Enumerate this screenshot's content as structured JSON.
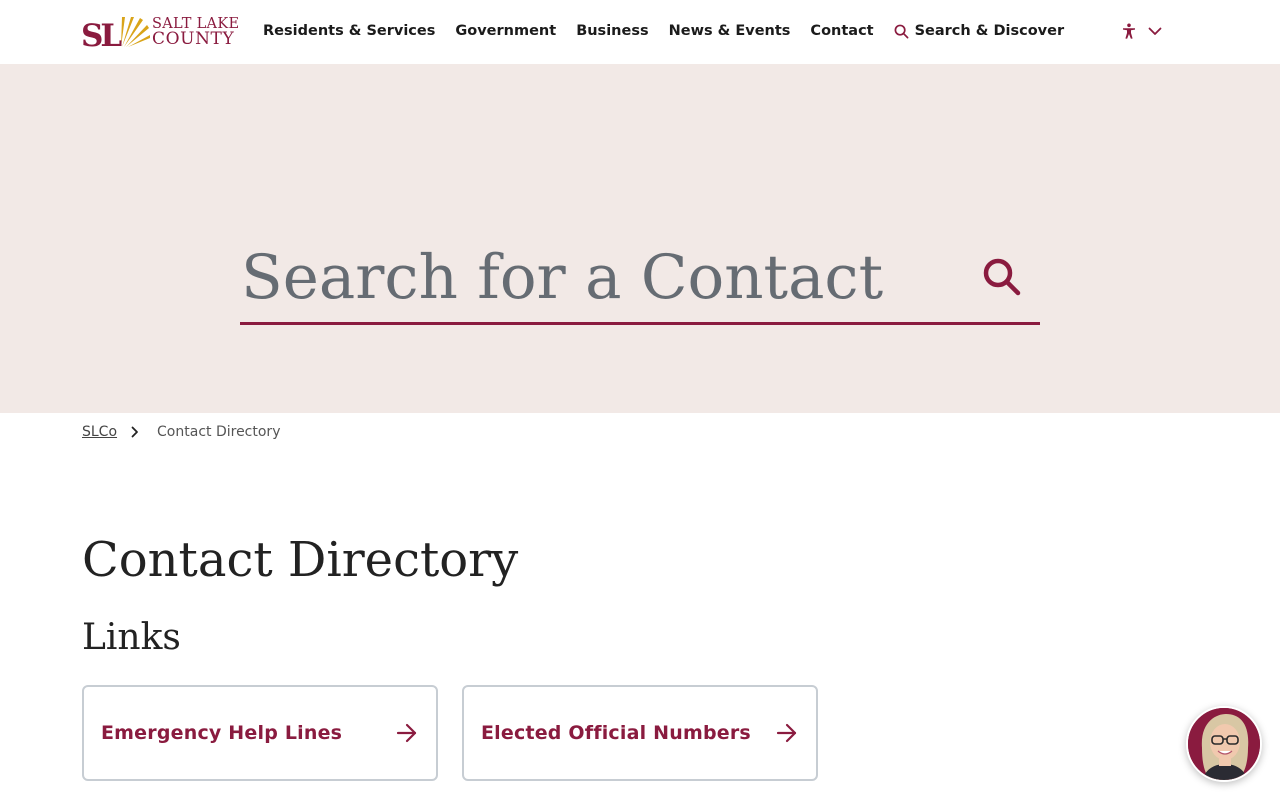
{
  "header": {
    "logo": {
      "line1": "SALT LAKE",
      "line2": "COUNTY",
      "mark_text": "SL"
    },
    "nav": [
      {
        "label": "Residents & Services"
      },
      {
        "label": "Government"
      },
      {
        "label": "Business"
      },
      {
        "label": "News & Events"
      },
      {
        "label": "Contact"
      }
    ],
    "search_link": {
      "label": "Search & Discover",
      "icon": "search-icon"
    },
    "accessibility": {
      "icon": "accessibility-icon",
      "dropdown_icon": "chevron-down-icon"
    }
  },
  "hero": {
    "search": {
      "placeholder": "Search for a Contact",
      "value": "",
      "icon": "search-icon"
    }
  },
  "breadcrumb": {
    "items": [
      {
        "label": "SLCo"
      },
      {
        "label": "Contact Directory"
      }
    ]
  },
  "main": {
    "title": "Contact Directory",
    "links_heading": "Links",
    "cards": [
      {
        "label": "Emergency Help Lines",
        "icon": "arrow-right-icon"
      },
      {
        "label": "Elected Official Numbers",
        "icon": "arrow-right-icon"
      }
    ]
  },
  "chat": {
    "icon": "chat-agent-avatar"
  },
  "colors": {
    "brand": "#8a1b3f",
    "brand_gold": "#d9a419",
    "hero_bg": "#f2e9e6",
    "card_border": "#c7cdd3",
    "placeholder": "#666c73"
  }
}
